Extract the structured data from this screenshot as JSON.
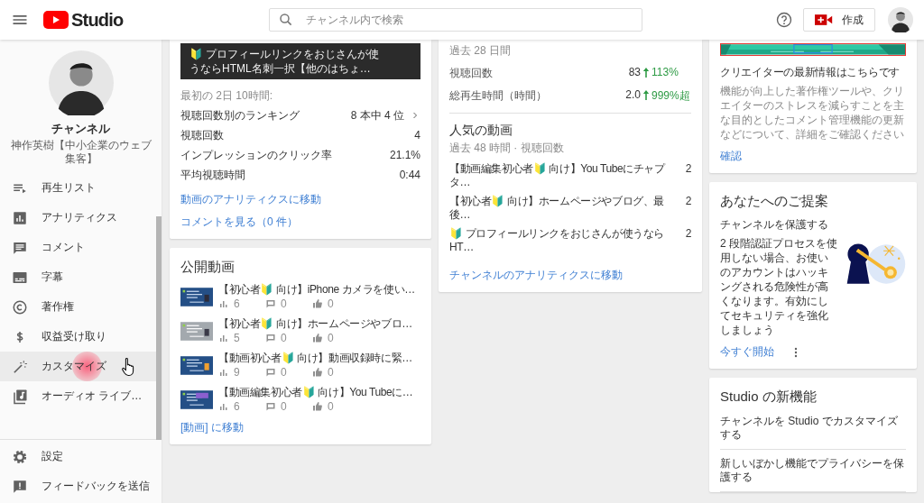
{
  "header": {
    "logo_text": "Studio",
    "search": {
      "placeholder": "チャンネル内で検索"
    },
    "create_button": "作成"
  },
  "sidebar": {
    "channel": {
      "heading": "チャンネル",
      "name": "神作英樹【中小企業のウェブ集客】"
    },
    "items": [
      {
        "label": "再生リスト",
        "highlighted": false
      },
      {
        "label": "アナリティクス",
        "highlighted": false
      },
      {
        "label": "コメント",
        "highlighted": false
      },
      {
        "label": "字幕",
        "highlighted": false
      },
      {
        "label": "著作権",
        "highlighted": false
      },
      {
        "label": "収益受け取り",
        "highlighted": false
      },
      {
        "label": "カスタマイズ",
        "highlighted": true
      },
      {
        "label": "オーディオ ライブ…",
        "highlighted": false
      }
    ],
    "bottom_items": [
      {
        "label": "設定"
      },
      {
        "label": "フィードバックを送信"
      }
    ]
  },
  "video_card": {
    "title_lines": [
      "🔰 プロフィールリンクをおじさんが使",
      "うならHTML名刺一択【他のはちょ…"
    ],
    "period": "最初の 2日 10時間:",
    "stats": [
      {
        "label": "視聴回数別のランキング",
        "value": "8 本中 4 位",
        "kind": "link"
      },
      {
        "label": "視聴回数",
        "value": "4",
        "kind": "plain"
      },
      {
        "label": "インプレッションのクリック率",
        "value": "21.1%",
        "kind": "plain"
      },
      {
        "label": "平均視聴時間",
        "value": "0:44",
        "kind": "plain"
      }
    ],
    "links": [
      "動画のアナリティクスに移動",
      "コメントを見る（0 件）"
    ]
  },
  "published_card": {
    "title": "公開動画",
    "videos": [
      {
        "title": "【初心者🔰 向け】iPhone カメラを使い…",
        "views": "6",
        "comments": "0",
        "likes": "0"
      },
      {
        "title": "【初心者🔰 向け】ホームページやブロ…",
        "views": "5",
        "comments": "0",
        "likes": "0"
      },
      {
        "title": "【動画初心者🔰 向け】動画収録時に緊…",
        "views": "9",
        "comments": "0",
        "likes": "0"
      },
      {
        "title": "【動画編集初心者🔰 向け】You Tubeに…",
        "views": "6",
        "comments": "0",
        "likes": "0"
      }
    ],
    "link": "[動画] に移動"
  },
  "analytics_card": {
    "period": "過去 28 日間",
    "metrics": [
      {
        "label": "視聴回数",
        "value": "83",
        "increase": true,
        "change": "113%"
      },
      {
        "label": "総再生時間（時間）",
        "value": "2.0",
        "increase": true,
        "change": "999%超"
      }
    ],
    "top_videos": {
      "title": "人気の動画",
      "subtitle": "過去 48 時間 · 視聴回数",
      "rows": [
        {
          "title": "【動画編集初心者🔰 向け】You Tubeにチャプタ…",
          "views": "2"
        },
        {
          "title": "【初心者🔰 向け】ホームページやブログ、最後…",
          "views": "2"
        },
        {
          "title": "🔰 プロフィールリンクをおじさんが使うならHT…",
          "views": "2"
        }
      ]
    },
    "link": "チャンネルのアナリティクスに移動"
  },
  "news_card": {
    "title": "クリエイターの最新情報はこちらです",
    "description": "機能が向上した著作権ツールや、クリエイターのストレスを減らすことを主な目的としたコメント管理機能の更新などについて、詳細をご確認ください",
    "link": "確認"
  },
  "suggestion_card": {
    "title": "あなたへのご提案",
    "subtitle": "チャンネルを保護する",
    "description": "2 段階認証プロセスを使用しない場合、お使いのアカウントはハッキングされる危険性が高くなります。有効にしてセキュリティを強化しましょう",
    "link": "今すぐ開始"
  },
  "whats_new_card": {
    "title": "Studio の新機能",
    "items": [
      "チャンネルを Studio でカスタマイズする",
      "新しいぼかし機能でプライバシーを保護する"
    ]
  }
}
